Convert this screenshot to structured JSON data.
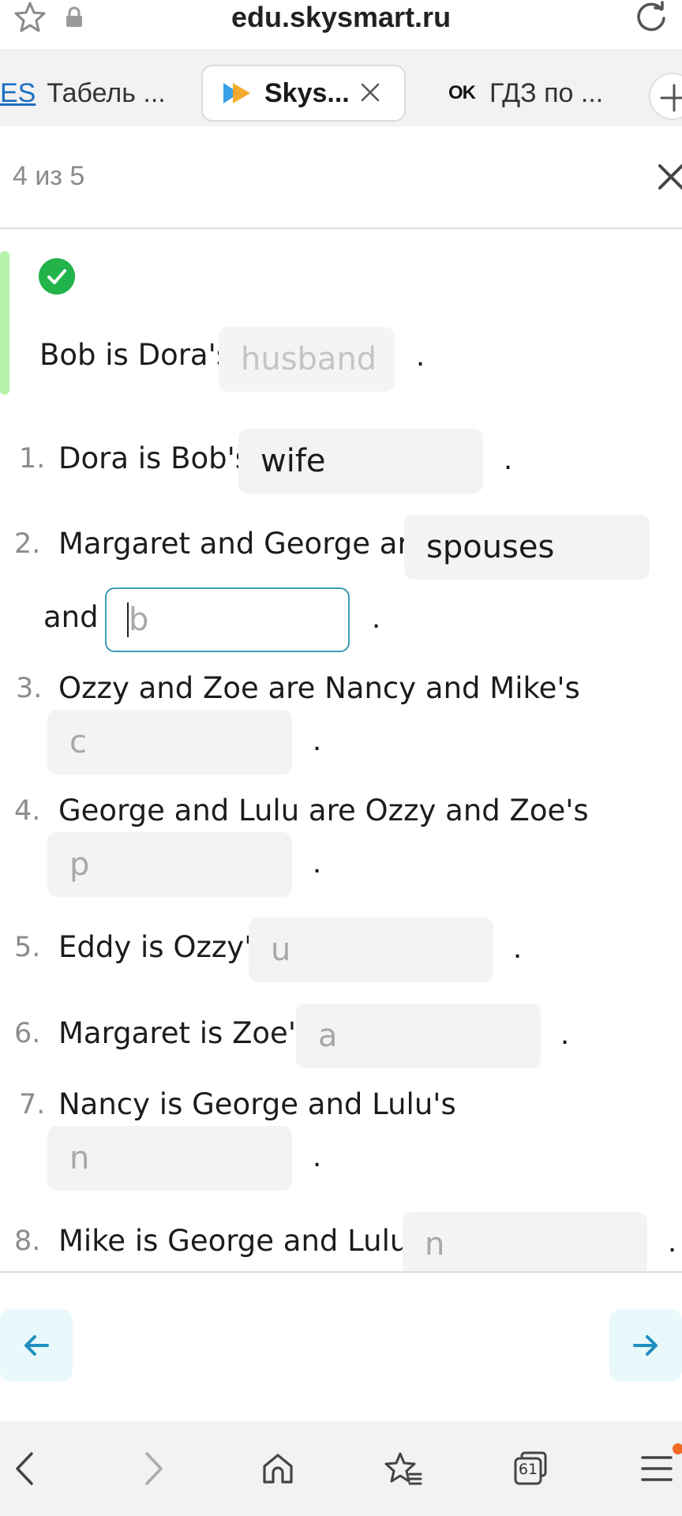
{
  "address_bar": {
    "url": "edu.skysmart.ru"
  },
  "tabs": [
    {
      "favicon_text": "ES",
      "title": "Табель ..."
    },
    {
      "title": "Skys...",
      "active": true
    },
    {
      "favicon_text": "OK",
      "title": "ГДЗ по ..."
    }
  ],
  "progress": {
    "counter": "4 из 5"
  },
  "example": {
    "text": "Bob is Dora's",
    "answer": "husband",
    "end": "."
  },
  "items": [
    {
      "num": "1.",
      "text": "Dora is Bob's",
      "value": "wife",
      "end": "."
    },
    {
      "num": "2.",
      "text": "Margaret and George are",
      "value": "spouses",
      "text2": "and",
      "value2": "b",
      "end": "."
    },
    {
      "num": "3.",
      "text": "Ozzy and Zoe are Nancy and Mike's",
      "value": "c",
      "end": "."
    },
    {
      "num": "4.",
      "text": "George and Lulu are Ozzy and Zoe's",
      "value": "p",
      "end": "."
    },
    {
      "num": "5.",
      "text": "Eddy is Ozzy's",
      "value": "u",
      "end": "."
    },
    {
      "num": "6.",
      "text": "Margaret is Zoe's",
      "value": "a",
      "end": "."
    },
    {
      "num": "7.",
      "text": "Nancy is George and Lulu's",
      "value": "n",
      "end": "."
    },
    {
      "num": "8.",
      "text": "Mike is George and Lulu's",
      "value": "n",
      "end": "."
    }
  ],
  "browser_bar": {
    "tab_count": "61"
  },
  "colors": {
    "accent": "#3d9cb8",
    "success": "#22b34a",
    "example_bar": "#b6f2a8",
    "nav_button_bg": "#e8f8fb",
    "notification": "#f26a21"
  }
}
